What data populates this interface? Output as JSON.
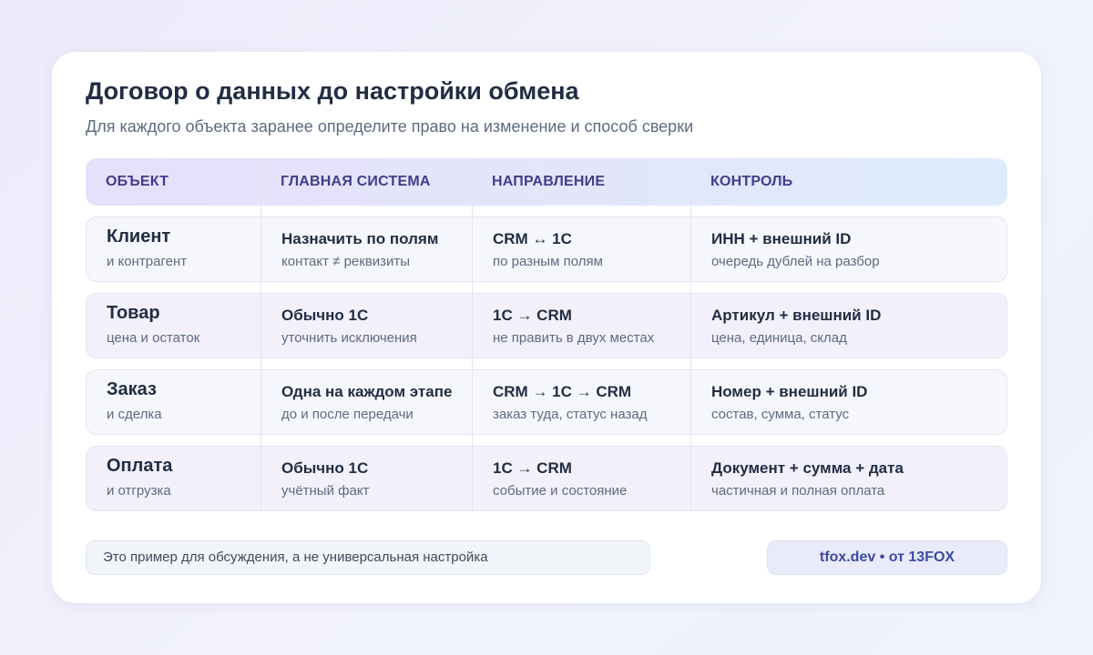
{
  "title": "Договор о данных до настройки обмена",
  "subtitle": "Для каждого объекта заранее определите право на изменение и способ сверки",
  "columns": [
    "ОБЪЕКТ",
    "ГЛАВНАЯ СИСТЕМА",
    "НАПРАВЛЕНИЕ",
    "КОНТРОЛЬ"
  ],
  "rows": [
    {
      "object": "Клиент",
      "object_sub": "и контрагент",
      "master": "Назначить по полям",
      "master_sub": "контакт ≠ реквизиты",
      "direction": "CRM ↔ 1С",
      "direction_sub": "по разным полям",
      "control": "ИНН + внешний ID",
      "control_sub": "очередь дублей на разбор"
    },
    {
      "object": "Товар",
      "object_sub": "цена и остаток",
      "master": "Обычно 1С",
      "master_sub": "уточнить исключения",
      "direction": "1С → CRM",
      "direction_sub": "не править в двух местах",
      "control": "Артикул + внешний ID",
      "control_sub": "цена, единица, склад"
    },
    {
      "object": "Заказ",
      "object_sub": "и сделка",
      "master": "Одна на каждом этапе",
      "master_sub": "до и после передачи",
      "direction": "CRM → 1С → CRM",
      "direction_sub": "заказ туда, статус назад",
      "control": "Номер + внешний ID",
      "control_sub": "состав, сумма, статус"
    },
    {
      "object": "Оплата",
      "object_sub": "и отгрузка",
      "master": "Обычно 1С",
      "master_sub": "учётный факт",
      "direction": "1С → CRM",
      "direction_sub": "событие и состояние",
      "control": "Документ + сумма + дата",
      "control_sub": "частичная и полная оплата"
    }
  ],
  "footer": {
    "note": "Это пример для обсуждения, а не универсальная настройка",
    "brand": "tfox.dev • от 13FOX"
  }
}
